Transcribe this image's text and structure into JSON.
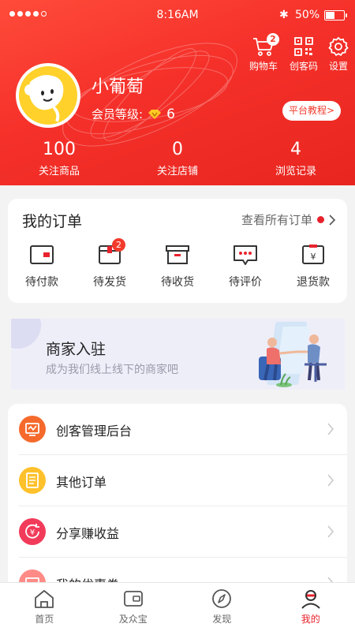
{
  "status_bar": {
    "time": "8:16AM",
    "battery": "50%",
    "bluetooth": "✱"
  },
  "header_actions": [
    {
      "label": "购物车",
      "icon": "cart-icon",
      "badge": "2"
    },
    {
      "label": "创客码",
      "icon": "qr-code-icon"
    },
    {
      "label": "设置",
      "icon": "gear-icon"
    }
  ],
  "profile": {
    "username": "小葡萄",
    "member_label": "会员等级:",
    "member_level": "6",
    "tutorial_button": "平台教程>"
  },
  "stats": [
    {
      "value": "100",
      "label": "关注商品"
    },
    {
      "value": "0",
      "label": "关注店铺"
    },
    {
      "value": "4",
      "label": "浏览记录"
    }
  ],
  "orders": {
    "title": "我的订单",
    "view_all": "查看所有订单",
    "items": [
      {
        "label": "待付款",
        "icon": "wallet-icon",
        "badge": ""
      },
      {
        "label": "待发货",
        "icon": "package-icon",
        "badge": "2"
      },
      {
        "label": "待收货",
        "icon": "box-icon",
        "badge": ""
      },
      {
        "label": "待评价",
        "icon": "comment-icon",
        "badge": ""
      },
      {
        "label": "退货款",
        "icon": "refund-icon",
        "badge": ""
      }
    ]
  },
  "merchant_banner": {
    "title": "商家入驻",
    "subtitle": "成为我们线上线下的商家吧"
  },
  "menu": [
    {
      "label": "创客管理后台",
      "icon": "dashboard-icon",
      "color": "#f56a2c"
    },
    {
      "label": "其他订单",
      "icon": "list-icon",
      "color": "#ffc12b"
    },
    {
      "label": "分享赚收益",
      "icon": "share-earn-icon",
      "color": "#f23b5a"
    },
    {
      "label": "我的优惠券",
      "icon": "coupon-icon",
      "color": "#ff8a86"
    }
  ],
  "tabs": [
    {
      "label": "首页",
      "icon": "home-icon",
      "active": false
    },
    {
      "label": "及众宝",
      "icon": "wallet-icon",
      "active": false
    },
    {
      "label": "发现",
      "icon": "compass-icon",
      "active": false
    },
    {
      "label": "我的",
      "icon": "profile-icon",
      "active": true
    }
  ],
  "colors": {
    "brand": "#f23b2c",
    "active_tab": "#e8222c"
  }
}
